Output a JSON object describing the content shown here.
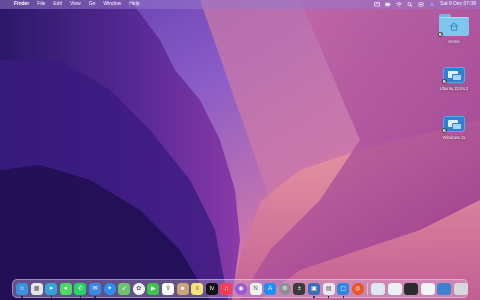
{
  "menubar": {
    "active_app": "Finder",
    "items": [
      "File",
      "Edit",
      "View",
      "Go",
      "Window",
      "Help"
    ],
    "status_icons": [
      "screen-mirroring-icon",
      "battery-icon",
      "wifi-icon",
      "search-icon",
      "control-center-icon",
      "siri-icon"
    ],
    "clock": "Sat 9 Dec  07:38"
  },
  "desktop": {
    "icons": [
      {
        "label": "Home",
        "icon": "home-folder-icon",
        "is_alias": true
      },
      {
        "label": "Ubuntu 22.04.2",
        "icon": "vm-icon",
        "is_alias": true
      },
      {
        "label": "Windows 11",
        "icon": "vm-icon",
        "is_alias": true
      }
    ]
  },
  "dock": {
    "apps": [
      {
        "name": "finder-icon",
        "color": "#3d8fe0",
        "glyph": "☺",
        "running": true
      },
      {
        "name": "launchpad-icon",
        "color": "#e6e6ea",
        "glyph": "▦",
        "running": false
      },
      {
        "name": "telegram-icon",
        "color": "#34a3dc",
        "glyph": "➤",
        "running": true
      },
      {
        "name": "messages-icon",
        "color": "#4cd964",
        "glyph": "●",
        "running": false
      },
      {
        "name": "whatsapp-icon",
        "color": "#25d366",
        "glyph": "✆",
        "running": true
      },
      {
        "name": "mail-icon",
        "color": "#3f86e6",
        "glyph": "✉",
        "running": true
      },
      {
        "name": "safari-icon",
        "color": "#2e8ef0",
        "glyph": "✦",
        "running": false
      },
      {
        "name": "maps-icon",
        "color": "#6cc46e",
        "glyph": "➶",
        "running": false
      },
      {
        "name": "photos-icon",
        "color": "#f5f5f5",
        "glyph": "✿",
        "running": false
      },
      {
        "name": "facetime-icon",
        "color": "#3cc44c",
        "glyph": "▶",
        "running": false
      },
      {
        "name": "calendar-icon",
        "color": "#ffffff",
        "glyph": "9",
        "running": false
      },
      {
        "name": "contacts-icon",
        "color": "#c9a27a",
        "glyph": "☻",
        "running": false
      },
      {
        "name": "notes-icon",
        "color": "#f7e27a",
        "glyph": "≡",
        "running": false
      },
      {
        "name": "apple-tv-icon",
        "color": "#111111",
        "glyph": "tv",
        "running": false
      },
      {
        "name": "music-icon",
        "color": "#fa3c55",
        "glyph": "♫",
        "running": false
      },
      {
        "name": "podcasts-icon",
        "color": "#9b59d6",
        "glyph": "◉",
        "running": false
      },
      {
        "name": "news-icon",
        "color": "#f2f2f2",
        "glyph": "N",
        "running": false
      },
      {
        "name": "app-store-icon",
        "color": "#1f8ff5",
        "glyph": "A",
        "running": false
      },
      {
        "name": "system-settings-icon",
        "color": "#8e8e93",
        "glyph": "⚙",
        "running": false
      },
      {
        "name": "calculator-icon",
        "color": "#3a3a3c",
        "glyph": "±",
        "running": false
      },
      {
        "name": "virtualbox-icon",
        "color": "#3b6fb6",
        "glyph": "▣",
        "running": true
      },
      {
        "name": "preview-icon",
        "color": "#e7e7ee",
        "glyph": "▤",
        "running": true
      },
      {
        "name": "window-app-icon",
        "color": "#2e86de",
        "glyph": "▢",
        "running": true
      },
      {
        "name": "ubuntu-icon",
        "color": "#e95420",
        "glyph": "◎",
        "running": false
      }
    ],
    "right_items": [
      {
        "name": "downloads-stack-icon",
        "color": "#dfe7f3"
      },
      {
        "name": "document-stack-icon",
        "color": "#eceff4"
      },
      {
        "name": "terminal-window-icon",
        "color": "#2b2b2b"
      },
      {
        "name": "finder-window-icon",
        "color": "#f4f4f4"
      },
      {
        "name": "drive-stack-icon",
        "color": "#3f7fd0"
      },
      {
        "name": "trash-icon",
        "color": "#d7d7dc"
      }
    ]
  }
}
